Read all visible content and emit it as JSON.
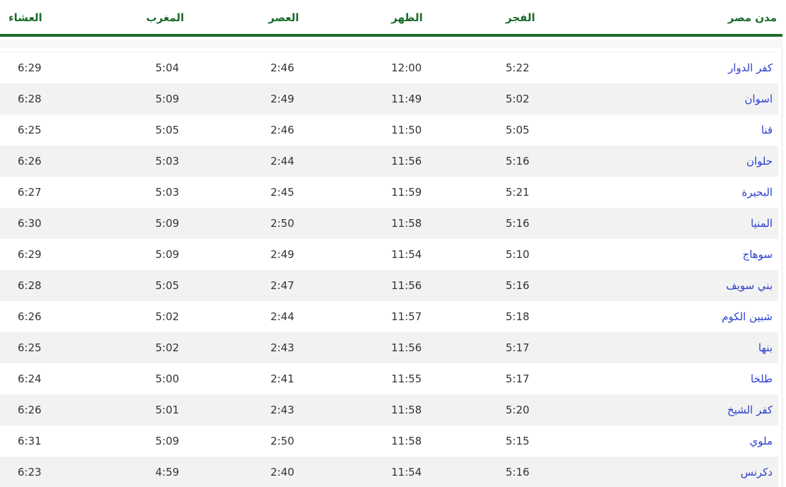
{
  "table": {
    "headers": {
      "city": "مدن مصر",
      "fajr": "الفجر",
      "dhuhr": "الظهر",
      "asr": "العصر",
      "maghrib": "المغرب",
      "isha": "العشاء"
    },
    "rows": [
      {
        "city": "كفر الدوار",
        "fajr": "5:22",
        "dhuhr": "12:00",
        "asr": "2:46",
        "maghrib": "5:04",
        "isha": "6:29"
      },
      {
        "city": "اسوان",
        "fajr": "5:02",
        "dhuhr": "11:49",
        "asr": "2:49",
        "maghrib": "5:09",
        "isha": "6:28"
      },
      {
        "city": "قنا",
        "fajr": "5:05",
        "dhuhr": "11:50",
        "asr": "2:46",
        "maghrib": "5:05",
        "isha": "6:25"
      },
      {
        "city": "حلوان",
        "fajr": "5:16",
        "dhuhr": "11:56",
        "asr": "2:44",
        "maghrib": "5:03",
        "isha": "6:26"
      },
      {
        "city": "البحيرة",
        "fajr": "5:21",
        "dhuhr": "11:59",
        "asr": "2:45",
        "maghrib": "5:03",
        "isha": "6:27"
      },
      {
        "city": "المنيا",
        "fajr": "5:16",
        "dhuhr": "11:58",
        "asr": "2:50",
        "maghrib": "5:09",
        "isha": "6:30"
      },
      {
        "city": "سوهاج",
        "fajr": "5:10",
        "dhuhr": "11:54",
        "asr": "2:49",
        "maghrib": "5:09",
        "isha": "6:29"
      },
      {
        "city": "بني سويف",
        "fajr": "5:16",
        "dhuhr": "11:56",
        "asr": "2:47",
        "maghrib": "5:05",
        "isha": "6:28"
      },
      {
        "city": "شبين الكوم",
        "fajr": "5:18",
        "dhuhr": "11:57",
        "asr": "2:44",
        "maghrib": "5:02",
        "isha": "6:26"
      },
      {
        "city": "بنها",
        "fajr": "5:17",
        "dhuhr": "11:56",
        "asr": "2:43",
        "maghrib": "5:02",
        "isha": "6:25"
      },
      {
        "city": "طلخا",
        "fajr": "5:17",
        "dhuhr": "11:55",
        "asr": "2:41",
        "maghrib": "5:00",
        "isha": "6:24"
      },
      {
        "city": "كفر الشيخ",
        "fajr": "5:20",
        "dhuhr": "11:58",
        "asr": "2:43",
        "maghrib": "5:01",
        "isha": "6:26"
      },
      {
        "city": "ملوي",
        "fajr": "5:15",
        "dhuhr": "11:58",
        "asr": "2:50",
        "maghrib": "5:09",
        "isha": "6:31"
      },
      {
        "city": "دكرنس",
        "fajr": "5:16",
        "dhuhr": "11:54",
        "asr": "2:40",
        "maghrib": "4:59",
        "isha": "6:23"
      }
    ]
  },
  "colors": {
    "header_text": "#1a6a2c",
    "header_rule": "#1c6b30",
    "link": "#2b3fd0",
    "stripe": "#f2f2f2"
  }
}
